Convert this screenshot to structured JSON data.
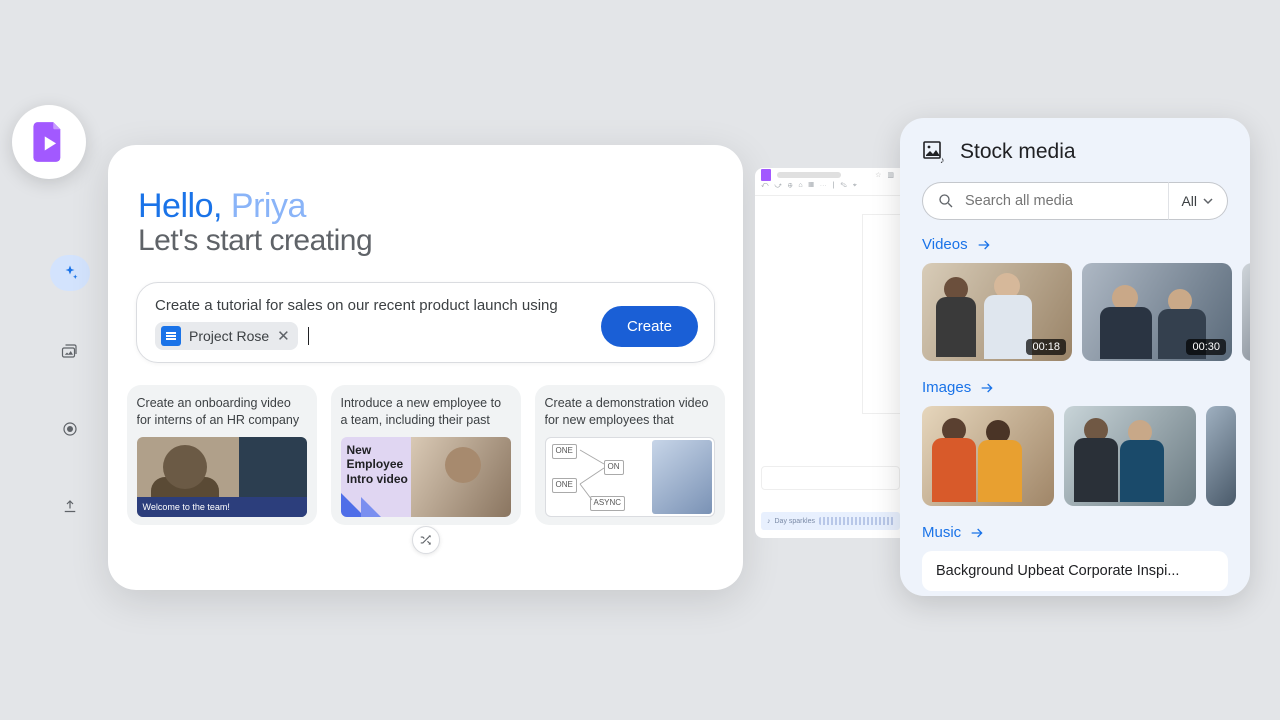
{
  "app": {
    "logo_color": "#a259ff"
  },
  "sidenav": {
    "items": [
      {
        "name": "sparkle",
        "active": true
      },
      {
        "name": "media",
        "active": false
      },
      {
        "name": "record",
        "active": false
      },
      {
        "name": "upload",
        "active": false
      }
    ]
  },
  "greeting": {
    "hello": "Hello,",
    "name": "Priya",
    "subtitle": "Let's start creating"
  },
  "prompt": {
    "text": "Create a tutorial for sales on our recent product launch using",
    "chip_label": "Project Rose",
    "create_label": "Create"
  },
  "templates": [
    {
      "desc": "Create an onboarding video for interns of an HR company",
      "caption": "Welcome to the team!"
    },
    {
      "desc": "Introduce a new employee to a team, including their past roles...",
      "thumb_text": "New Employee Intro video"
    },
    {
      "desc": "Create a demonstration video for new employees that details...",
      "nodes": [
        "ONE",
        "ON",
        "ONE",
        "ASYNC"
      ]
    }
  ],
  "editor_ghost": {
    "timeline_label": "Day sparkles"
  },
  "media": {
    "title": "Stock media",
    "search_placeholder": "Search all media",
    "filter_label": "All",
    "sections": {
      "videos": {
        "label": "Videos",
        "items": [
          {
            "duration": "00:18"
          },
          {
            "duration": "00:30"
          }
        ]
      },
      "images": {
        "label": "Images"
      },
      "music": {
        "label": "Music",
        "track": "Background Upbeat Corporate Inspi..."
      }
    }
  }
}
